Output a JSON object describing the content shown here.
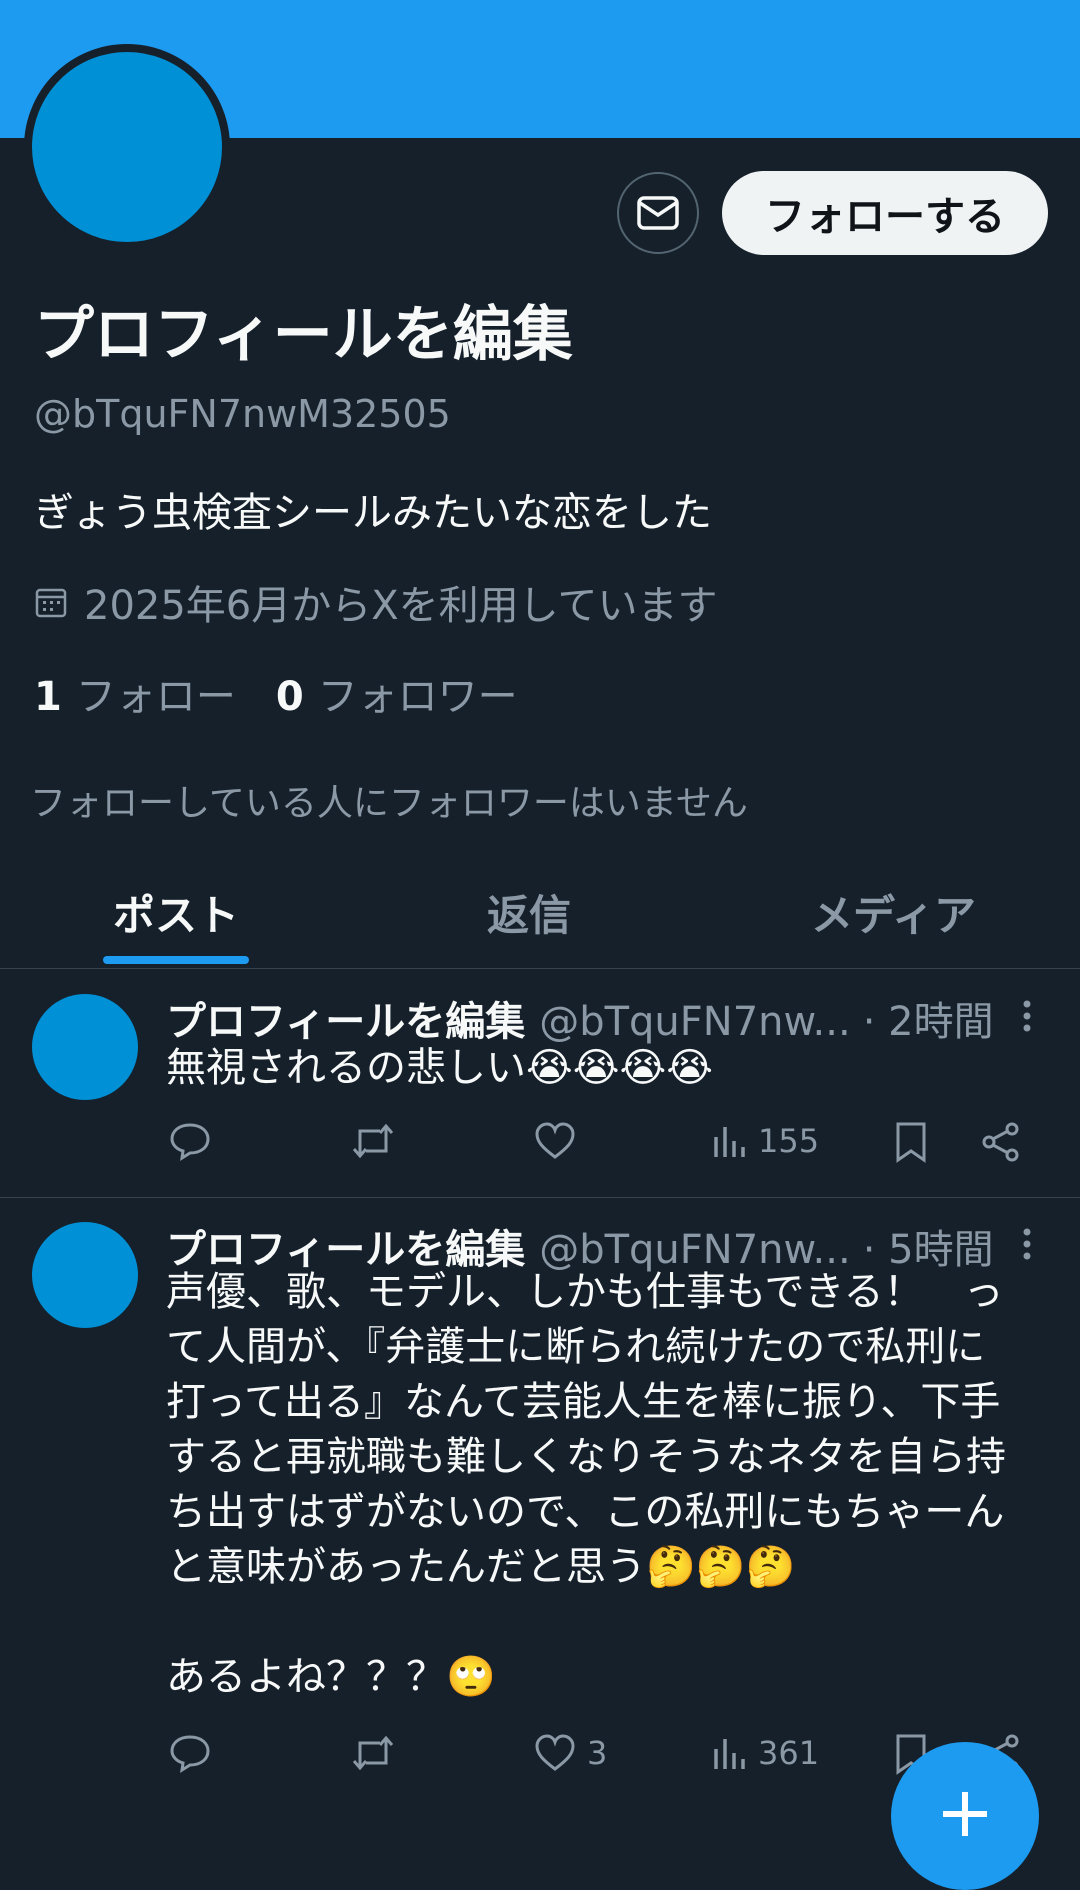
{
  "profile": {
    "display_name": "プロフィールを編集",
    "handle": "@bTquFN7nwM32505",
    "bio": "ぎょう虫検査シールみたいな恋をした",
    "joined": "2025年6月からXを利用しています",
    "following_count": "1",
    "following_label": "フォロー",
    "followers_count": "0",
    "followers_label": "フォロワー",
    "followers_note": "フォローしている人にフォロワーはいません",
    "follow_button": "フォローする",
    "accent_color": "#1d9bf0"
  },
  "tabs": [
    {
      "label": "ポスト",
      "active": true
    },
    {
      "label": "返信",
      "active": false
    },
    {
      "label": "メディア",
      "active": false
    }
  ],
  "posts": [
    {
      "name": "プロフィールを編集",
      "handle": "@bTquFN7nw...",
      "time": "· 2時間",
      "text": "無視されるの悲しい😭😭😭😭",
      "likes": "",
      "views": "155"
    },
    {
      "name": "プロフィールを編集",
      "handle": "@bTquFN7nw...",
      "time": "· 5時間",
      "text": "声優、歌、モデル、しかも仕事もできる！　っ\nて人間が、『弁護士に断られ続けたので私刑に\n打って出る』なんて芸能人生を棒に振り、下手\nすると再就職も難しくなりそうなネタを自ら持\nち出すはずがないので、この私刑にもちゃーん\nと意味があったんだと思う🤔🤔🤔\n\nあるよね？？？🙄",
      "likes": "3",
      "views": "361"
    }
  ],
  "icons": [
    "envelope-icon",
    "calendar-icon",
    "more-icon",
    "reply-icon",
    "repost-icon",
    "like-icon",
    "views-icon",
    "bookmark-icon",
    "share-icon",
    "plus-icon"
  ]
}
